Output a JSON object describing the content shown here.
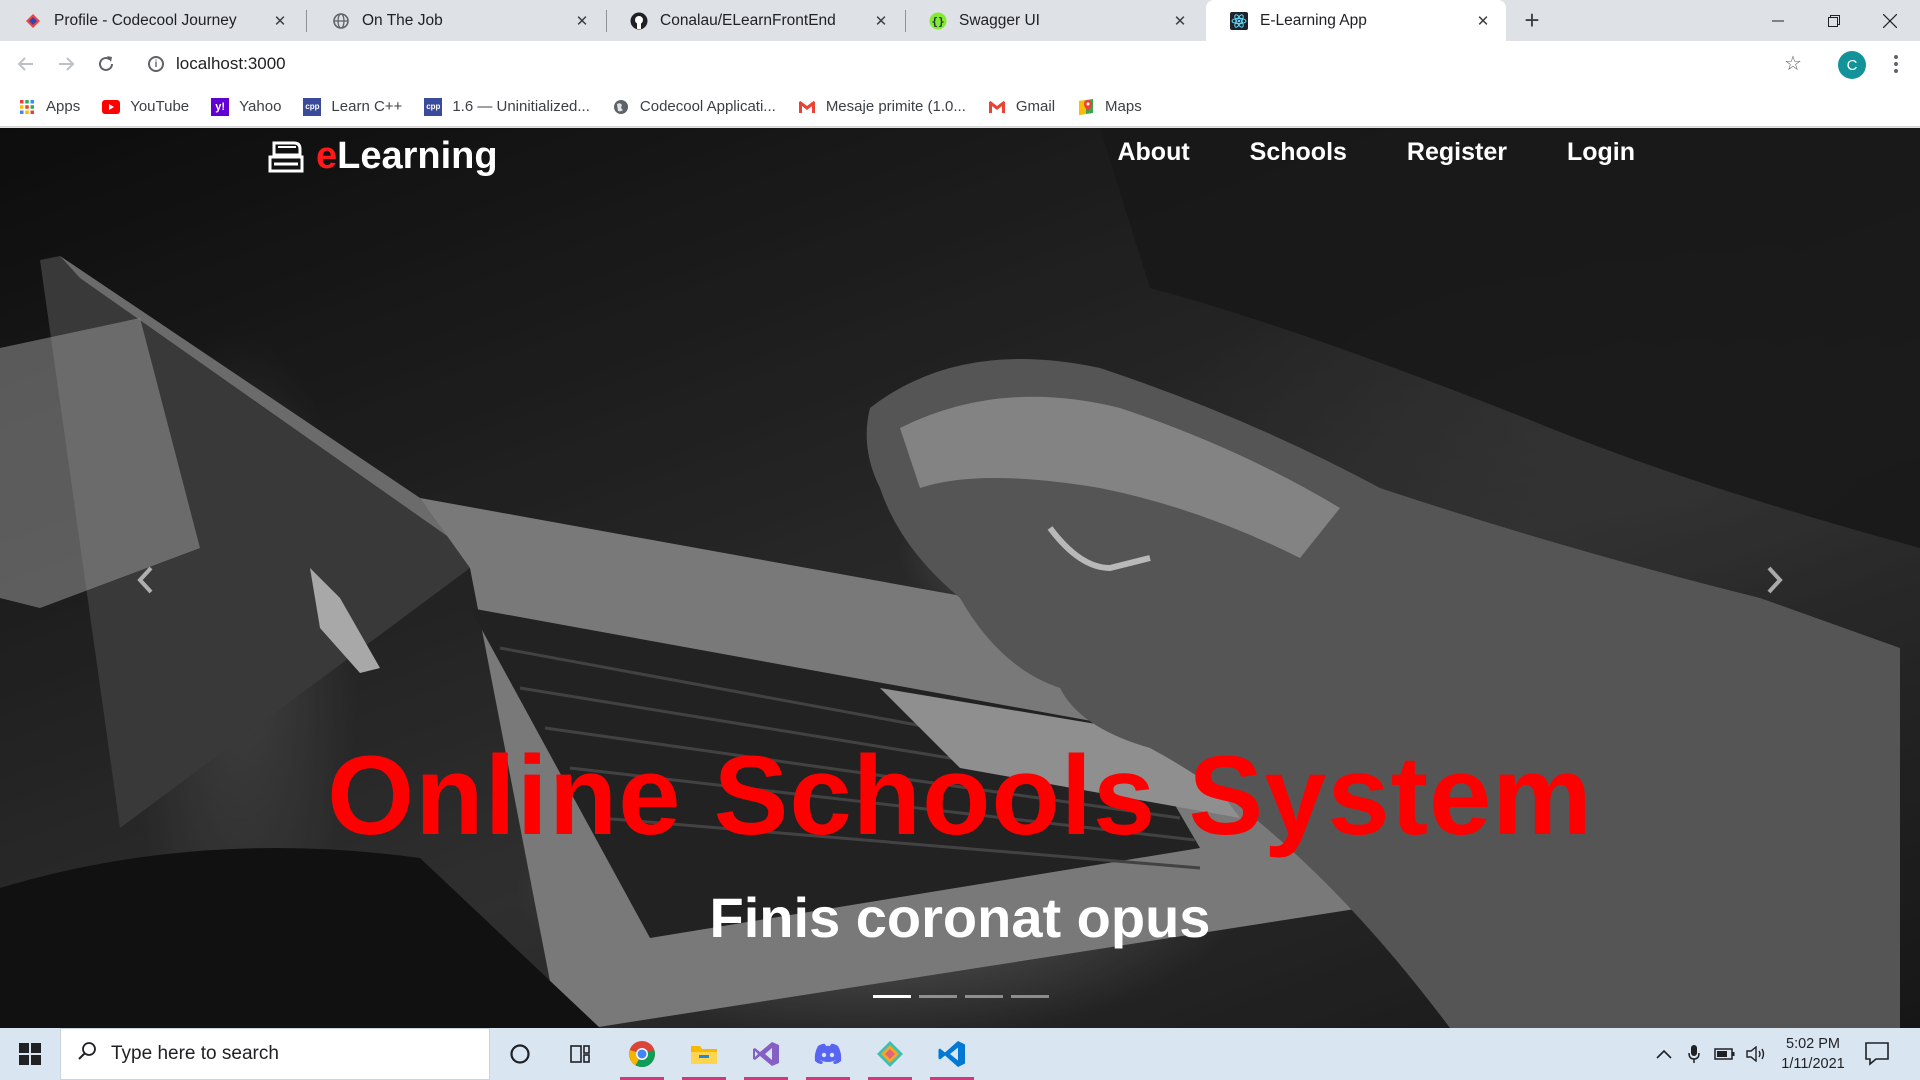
{
  "browser": {
    "tabs": [
      {
        "title": "Profile - Codecool Journey",
        "icon": "codecool-icon",
        "active": false
      },
      {
        "title": "On The Job",
        "icon": "globe-icon",
        "active": false
      },
      {
        "title": "Conalau/ELearnFrontEnd",
        "icon": "github-icon",
        "active": false
      },
      {
        "title": "Swagger UI",
        "icon": "swagger-icon",
        "active": false
      },
      {
        "title": "E-Learning App",
        "icon": "react-icon",
        "active": true
      }
    ],
    "address": "localhost:3000",
    "profile_initial": "C",
    "bookmarks": [
      {
        "label": "Apps",
        "icon": "apps-grid-icon"
      },
      {
        "label": "YouTube",
        "icon": "youtube-icon"
      },
      {
        "label": "Yahoo",
        "icon": "yahoo-icon"
      },
      {
        "label": "Learn C++",
        "icon": "cpp-icon"
      },
      {
        "label": "1.6 — Uninitialized...",
        "icon": "cpp-icon"
      },
      {
        "label": "Codecool Applicati...",
        "icon": "globe-icon"
      },
      {
        "label": "Mesaje primite (1.0...",
        "icon": "gmail-icon"
      },
      {
        "label": "Gmail",
        "icon": "gmail-icon"
      },
      {
        "label": "Maps",
        "icon": "maps-icon"
      }
    ]
  },
  "site": {
    "brand_prefix": "e",
    "brand_rest": "Learning",
    "nav": [
      "About",
      "Schools",
      "Register",
      "Login"
    ],
    "hero": {
      "title": "Online Schools System",
      "subtitle": "Finis coronat opus",
      "slide_count": 4,
      "active_slide": 1
    }
  },
  "taskbar": {
    "search_placeholder": "Type here to search",
    "time": "5:02 PM",
    "date": "1/11/2021",
    "apps": [
      "chrome-icon",
      "file-explorer-icon",
      "visual-studio-icon",
      "discord-icon",
      "git-kraken-icon",
      "vscode-icon"
    ]
  },
  "colors": {
    "brand_accent": "#ff1a1a",
    "hero_title": "#ff0000",
    "tab_strip": "#dee1e6",
    "taskbar": "#d9e6f2"
  }
}
